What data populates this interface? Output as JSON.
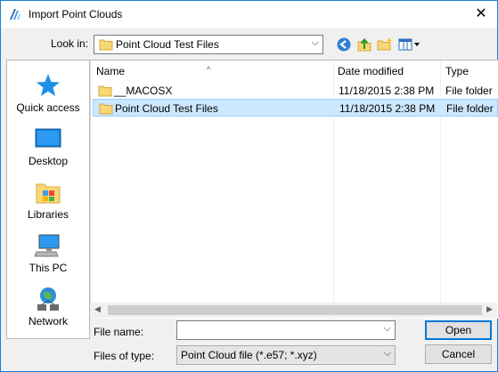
{
  "window": {
    "title": "Import Point Clouds",
    "close_glyph": "✕"
  },
  "lookin": {
    "label": "Look in:",
    "value": "Point Cloud Test Files",
    "arrow": "⌵"
  },
  "toolbar": {
    "back_icon": "back-icon",
    "up_icon": "up-folder-icon",
    "new_folder_icon": "new-folder-icon",
    "views_icon": "views-menu-icon"
  },
  "places": [
    {
      "label": "Quick access",
      "icon": "star-icon"
    },
    {
      "label": "Desktop",
      "icon": "desktop-icon"
    },
    {
      "label": "Libraries",
      "icon": "libraries-icon"
    },
    {
      "label": "This PC",
      "icon": "computer-icon"
    },
    {
      "label": "Network",
      "icon": "network-icon"
    }
  ],
  "columns": {
    "name": "Name",
    "date": "Date modified",
    "type": "Type"
  },
  "files": [
    {
      "name": "__MACOSX",
      "date": "11/18/2015 2:38 PM",
      "type": "File folder",
      "selected": false
    },
    {
      "name": "Point Cloud Test Files",
      "date": "11/18/2015 2:38 PM",
      "type": "File folder",
      "selected": true
    }
  ],
  "filename": {
    "label": "File name:",
    "value": "",
    "arrow": "⌵"
  },
  "filetype": {
    "label": "Files of type:",
    "value": "Point Cloud file (*.e57; *.xyz)",
    "arrow": "⌵"
  },
  "buttons": {
    "open": "Open",
    "cancel": "Cancel"
  },
  "colors": {
    "accent": "#0078d7",
    "selection": "#cce8ff",
    "folder": "#f8d775"
  }
}
